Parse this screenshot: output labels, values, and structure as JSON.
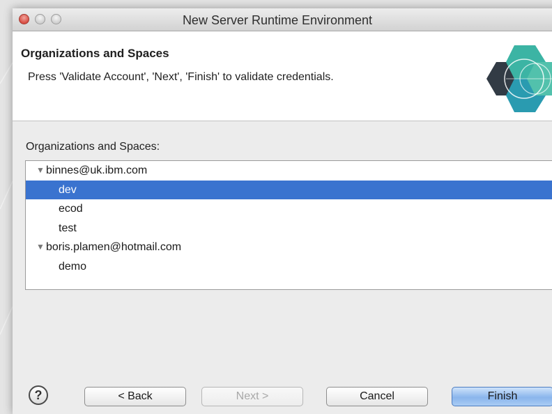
{
  "window": {
    "title": "New Server Runtime Environment"
  },
  "header": {
    "title": "Organizations and Spaces",
    "description": "Press 'Validate Account', 'Next', 'Finish' to validate credentials."
  },
  "section": {
    "label": "Organizations and Spaces:"
  },
  "tree": {
    "organizations": [
      {
        "name": "binnes@uk.ibm.com",
        "expanded": true,
        "spaces": [
          "dev",
          "ecod",
          "test"
        ]
      },
      {
        "name": "boris.plamen@hotmail.com",
        "expanded": true,
        "spaces": [
          "demo"
        ]
      }
    ],
    "selected": "dev"
  },
  "buttons": {
    "help": "?",
    "back": "< Back",
    "next": "Next >",
    "cancel": "Cancel",
    "finish": "Finish"
  },
  "colors": {
    "selection": "#3a73cf",
    "default_button": "#8ab5ec",
    "logo_teal": "#3cb4a4",
    "logo_dark": "#323b45"
  }
}
